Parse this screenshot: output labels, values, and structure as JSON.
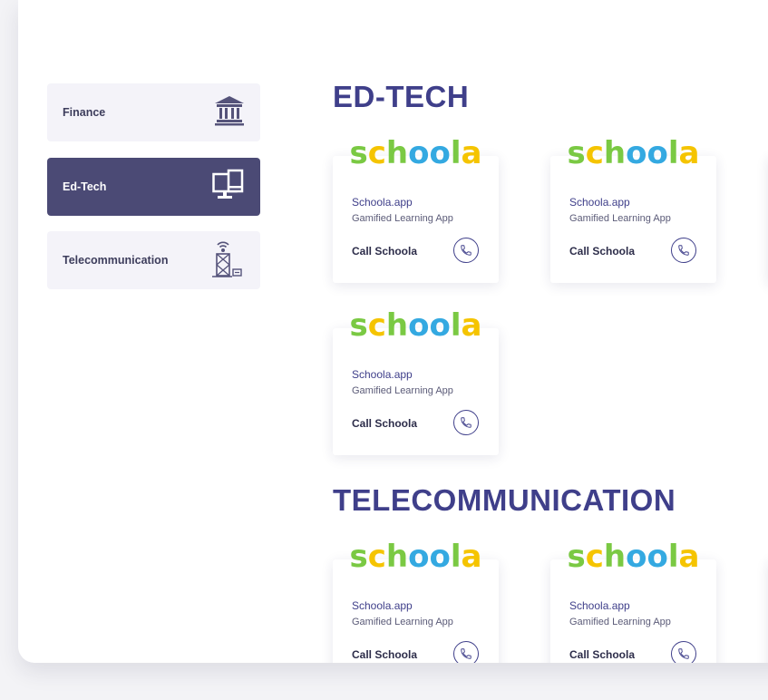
{
  "sidebar": {
    "items": [
      {
        "label": "Finance",
        "icon": "bank-icon",
        "active": false
      },
      {
        "label": "Ed-Tech",
        "icon": "computer-icon",
        "active": true
      },
      {
        "label": "Telecommunication",
        "icon": "tower-icon",
        "active": false
      }
    ]
  },
  "colors": {
    "accent": "#3f3f8a",
    "active_bg": "#4b4a75",
    "logo_green": "#7ac943",
    "logo_yellow": "#f5c400",
    "logo_blue": "#34a9e1"
  },
  "sections": [
    {
      "title": "ED-TECH",
      "cards": [
        {
          "logo": "schoola",
          "title": "Schoola.app",
          "subtitle": "Gamified Learning App",
          "call_label": "Call Schoola"
        },
        {
          "logo": "schoola",
          "title": "Schoola.app",
          "subtitle": "Gamified Learning App",
          "call_label": "Call Schoola"
        },
        {
          "logo": "schoola",
          "title": "Schoola.app",
          "subtitle": "Gamified Learning App",
          "call_label": "Call Schoola"
        }
      ]
    },
    {
      "title": "TELECOMMUNICATION",
      "cards": [
        {
          "logo": "schoola",
          "title": "Schoola.app",
          "subtitle": "Gamified Learning App",
          "call_label": "Call Schoola"
        },
        {
          "logo": "schoola",
          "title": "Schoola.app",
          "subtitle": "Gamified Learning App",
          "call_label": "Call Schoola"
        }
      ]
    }
  ]
}
